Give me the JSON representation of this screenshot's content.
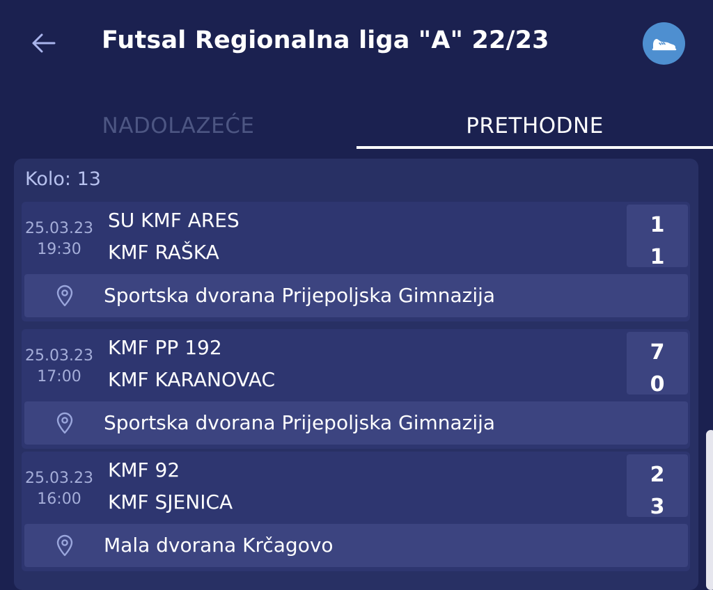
{
  "header": {
    "title": "Futsal Regionalna liga \"A\" 22/23",
    "back_icon": "arrow-left-icon",
    "sport_icon": "sneaker-icon",
    "sport_color": "#4e8fd0"
  },
  "tabs": [
    {
      "label": "NADOLAZEĆE",
      "active": false
    },
    {
      "label": "PRETHODNE",
      "active": true
    }
  ],
  "round": {
    "label": "Kolo: 13"
  },
  "matches": [
    {
      "date": "25.03.23",
      "time": "19:30",
      "home": "SU KMF ARES",
      "away": "KMF RAŠKA",
      "home_score": "1",
      "away_score": "1",
      "venue": "Sportska dvorana Prijepoljska Gimnazija"
    },
    {
      "date": "25.03.23",
      "time": "17:00",
      "home": "KMF PP 192",
      "away": "KMF KARANOVAC",
      "home_score": "7",
      "away_score": "0",
      "venue": "Sportska dvorana Prijepoljska Gimnazija"
    },
    {
      "date": "25.03.23",
      "time": "16:00",
      "home": "KMF 92",
      "away": "KMF SJENICA",
      "home_score": "2",
      "away_score": "3",
      "venue": "Mala dvorana Krčagovo"
    }
  ],
  "colors": {
    "background": "#1b2150",
    "card": "#283064",
    "accent": "#4e8fd0"
  }
}
